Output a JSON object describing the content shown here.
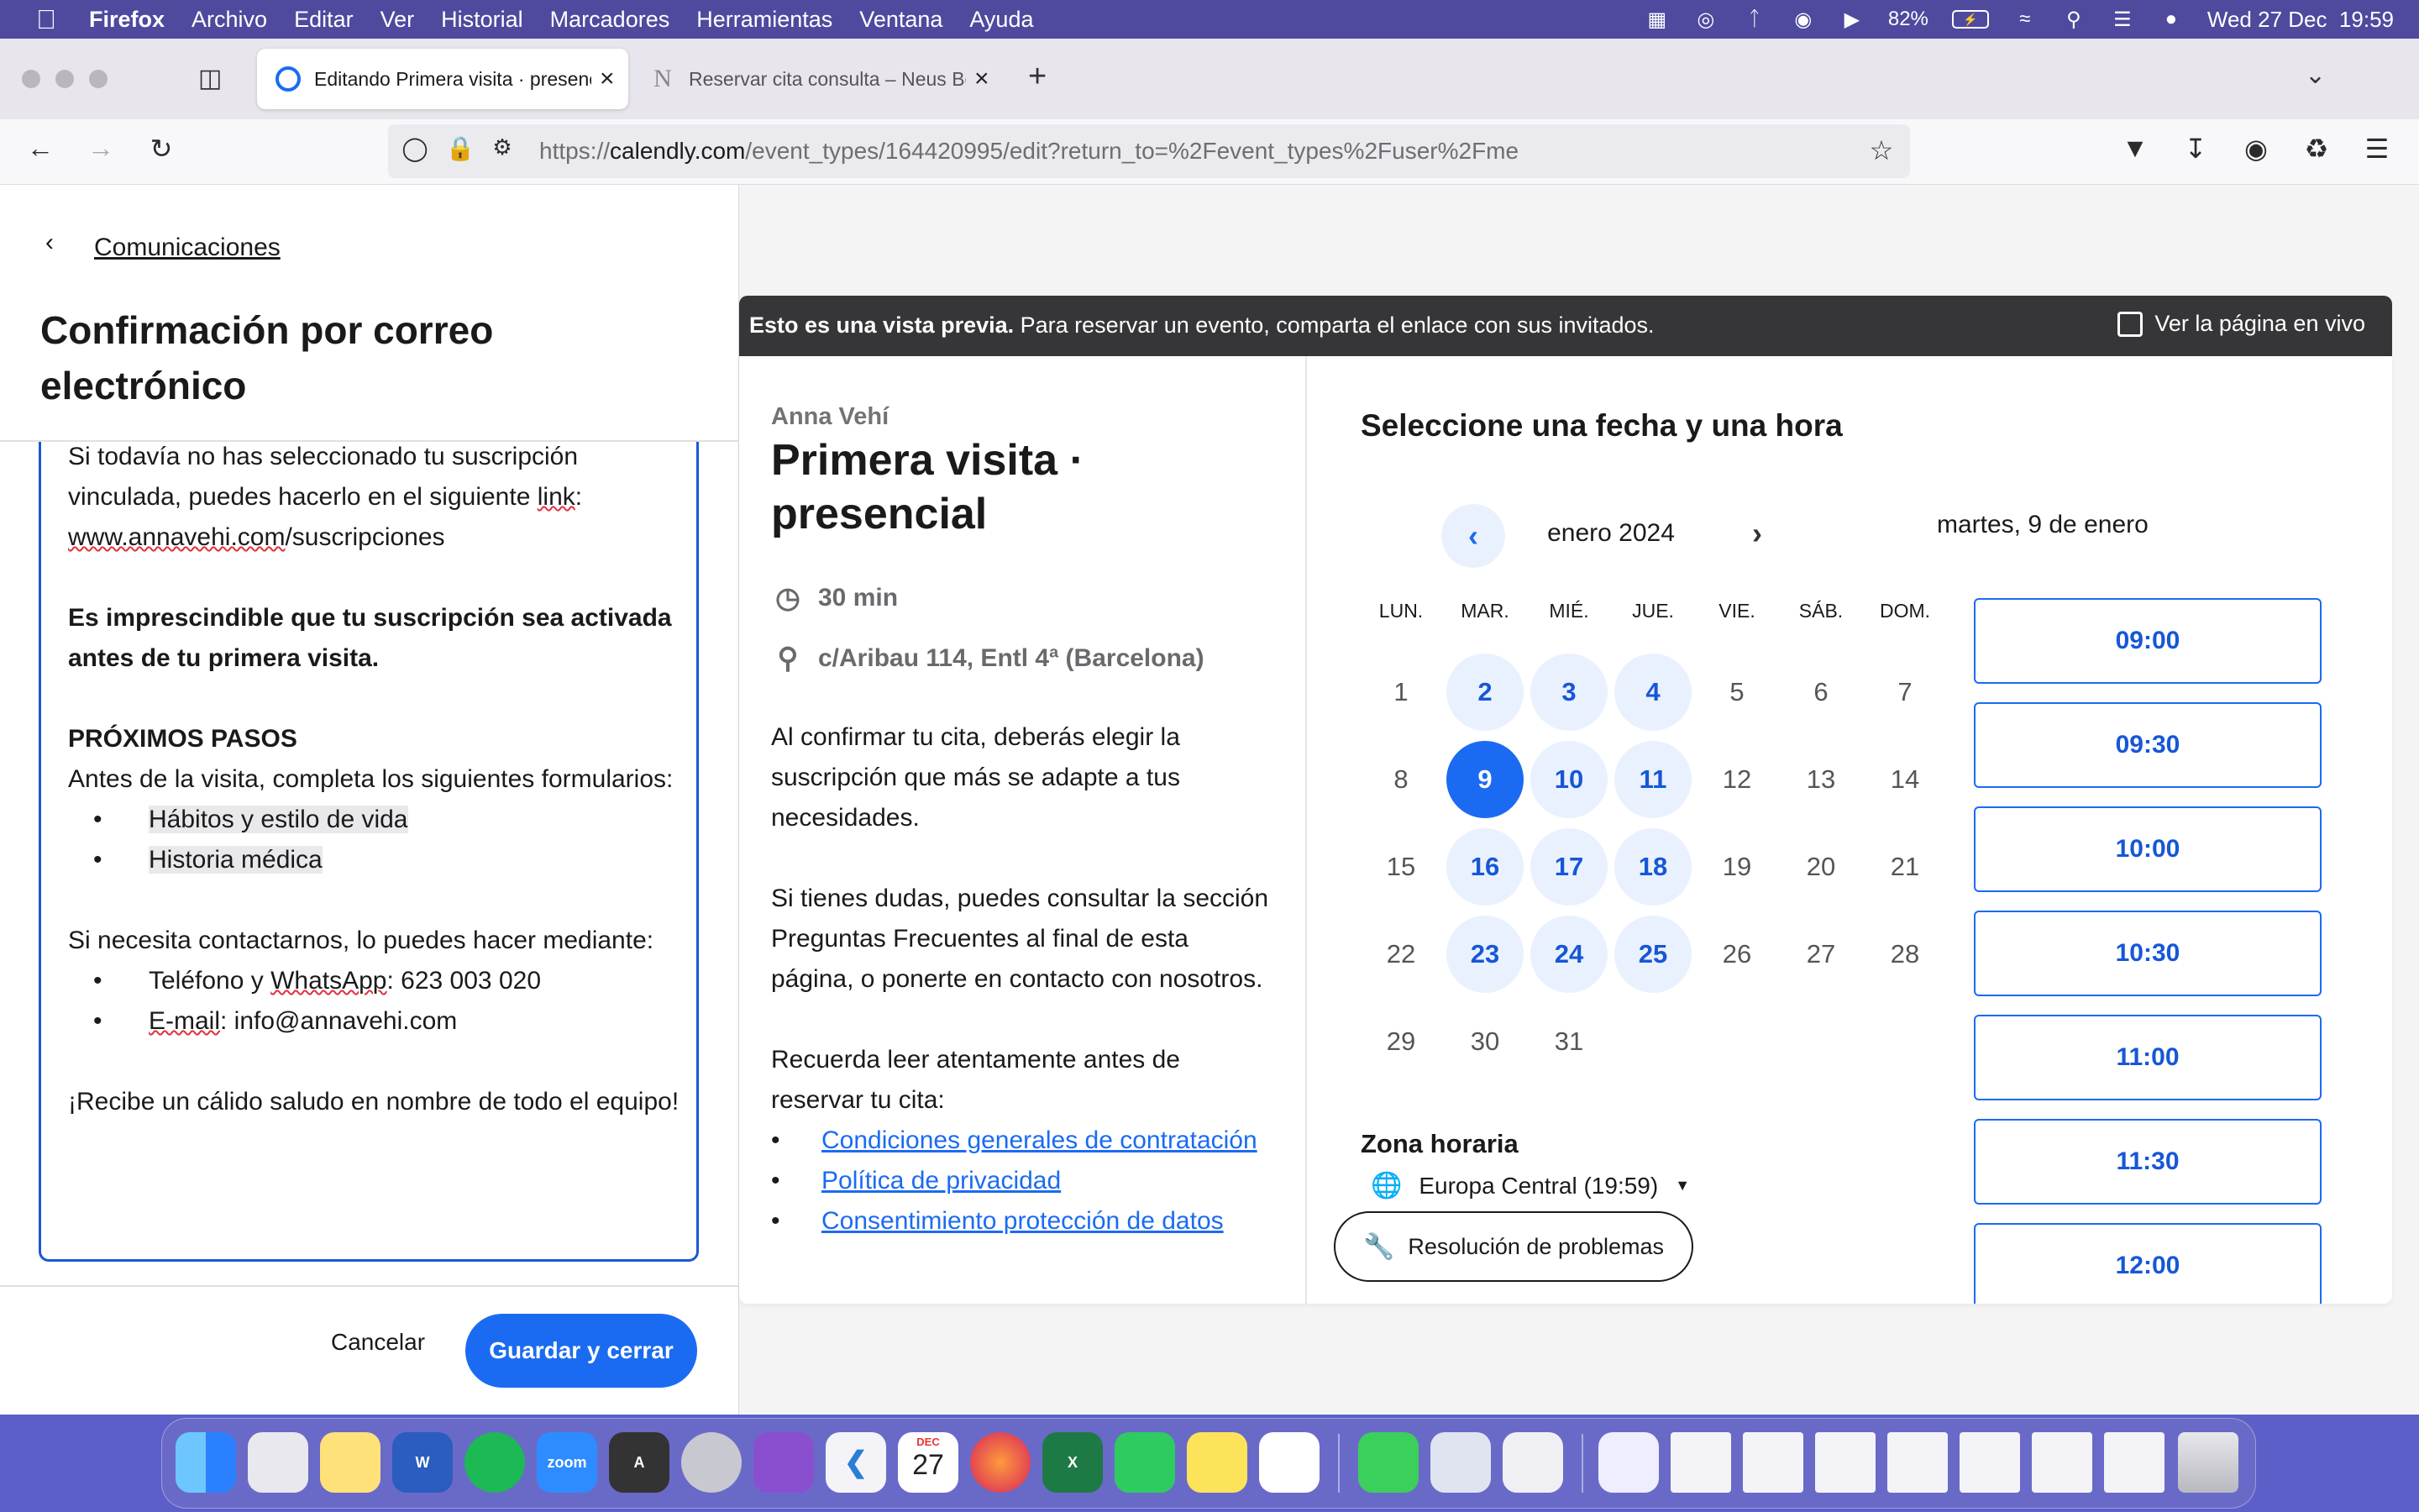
{
  "menubar": {
    "app_name": "Firefox",
    "items": [
      "Archivo",
      "Editar",
      "Ver",
      "Historial",
      "Marcadores",
      "Herramientas",
      "Ventana",
      "Ayuda"
    ],
    "battery": "82%",
    "datetime": "Wed 27 Dec  19:59"
  },
  "tabs": [
    {
      "title": "Editando Primera visita · presencial",
      "active": true
    },
    {
      "title": "Reservar cita consulta – Neus Bellavista",
      "active": false
    }
  ],
  "url": {
    "prefix": "https://",
    "domain": "calendly.com",
    "path": "/event_types/164420995/edit?return_to=%2Fevent_types%2Fuser%2Fme"
  },
  "editor": {
    "back_label": "Comunicaciones",
    "title": "Confirmación por correo electrónico",
    "body": {
      "p1_a": "Si todavía no has seleccionado tu suscripción vinculada, puedes hacerlo en el siguiente ",
      "p1_link": "link",
      "p1_b": ":",
      "p1_site_a": "www.annavehi.com",
      "p1_site_b": "/suscripciones",
      "p2": "Es imprescindible que tu suscripción sea activada antes de tu primera visita.",
      "p3_heading": "PRÓXIMOS PASOS",
      "p3_text": "Antes de la visita, completa los siguientes formularios:",
      "forms": [
        "Hábitos y estilo de vida",
        "Historia médica"
      ],
      "p4_text": "Si necesita contactarnos, lo puedes hacer mediante:",
      "contact_phone_a": "Teléfono y ",
      "contact_phone_b": "WhatsApp",
      "contact_phone_c": ": 623 003 020",
      "contact_email_a": "E-mail",
      "contact_email_b": ": info@annavehi.com",
      "p5": "¡Recibe un cálido saludo en nombre de todo el equipo!"
    },
    "cancel_label": "Cancelar",
    "save_label": "Guardar y cerrar"
  },
  "preview": {
    "banner_bold": "Esto es una vista previa.",
    "banner_text": " Para reservar un evento, comparta el enlace con sus invitados.",
    "live_label": "Ver la página en vivo",
    "host": "Anna Vehí",
    "event_title": "Primera visita · presencial",
    "duration": "30 min",
    "location": "c/Aribau 114, Entl 4ª (Barcelona)",
    "desc_p1": "Al confirmar tu cita, deberás elegir la suscripción que más se adapte a tus necesidades.",
    "desc_p2": "Si tienes dudas, puedes consultar la sección Preguntas Frecuentes al final de esta página, o ponerte en contacto con nosotros.",
    "desc_p3": "Recuerda leer atentamente antes de reservar tu cita:",
    "links": [
      "Condiciones generales de contratación",
      "Política de privacidad",
      "Consentimiento protección de datos"
    ],
    "schedule_title": "Seleccione una fecha y una hora",
    "month": "enero 2024",
    "selected_date": "martes, 9 de enero",
    "weekdays": [
      "LUN.",
      "MAR.",
      "MIÉ.",
      "JUE.",
      "VIE.",
      "SÁB.",
      "DOM."
    ],
    "days": [
      {
        "d": "1",
        "s": ""
      },
      {
        "d": "2",
        "s": "avail"
      },
      {
        "d": "3",
        "s": "avail"
      },
      {
        "d": "4",
        "s": "avail"
      },
      {
        "d": "5",
        "s": ""
      },
      {
        "d": "6",
        "s": ""
      },
      {
        "d": "7",
        "s": ""
      },
      {
        "d": "8",
        "s": ""
      },
      {
        "d": "9",
        "s": "sel"
      },
      {
        "d": "10",
        "s": "avail"
      },
      {
        "d": "11",
        "s": "avail"
      },
      {
        "d": "12",
        "s": ""
      },
      {
        "d": "13",
        "s": ""
      },
      {
        "d": "14",
        "s": ""
      },
      {
        "d": "15",
        "s": ""
      },
      {
        "d": "16",
        "s": "avail"
      },
      {
        "d": "17",
        "s": "avail"
      },
      {
        "d": "18",
        "s": "avail"
      },
      {
        "d": "19",
        "s": ""
      },
      {
        "d": "20",
        "s": ""
      },
      {
        "d": "21",
        "s": ""
      },
      {
        "d": "22",
        "s": ""
      },
      {
        "d": "23",
        "s": "avail"
      },
      {
        "d": "24",
        "s": "avail"
      },
      {
        "d": "25",
        "s": "avail"
      },
      {
        "d": "26",
        "s": ""
      },
      {
        "d": "27",
        "s": ""
      },
      {
        "d": "28",
        "s": ""
      },
      {
        "d": "29",
        "s": ""
      },
      {
        "d": "30",
        "s": ""
      },
      {
        "d": "31",
        "s": ""
      }
    ],
    "timezone_label": "Zona horaria",
    "timezone_value": "Europa Central (19:59)",
    "trouble_label": "Resolución de problemas",
    "slots": [
      "09:00",
      "09:30",
      "10:00",
      "10:30",
      "11:00",
      "11:30",
      "12:00"
    ]
  },
  "dock": {
    "zoom_label": "zoom",
    "calendar_month": "DEC",
    "calendar_day": "27"
  },
  "colors": {
    "accent": "#1b6bf2",
    "menubar": "#4f4a9e",
    "banner": "#363638"
  }
}
